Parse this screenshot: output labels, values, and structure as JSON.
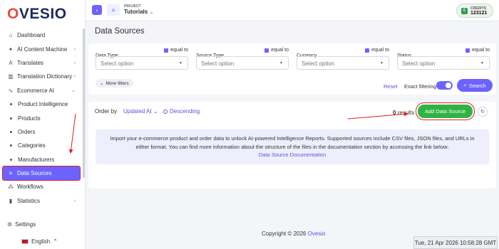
{
  "brand": {
    "logo_text": "OVESIO"
  },
  "sidebar": {
    "items": [
      {
        "label": "Dashboard",
        "icon": "home-icon"
      },
      {
        "label": "AI Content Machine",
        "icon": "sparkle-icon"
      },
      {
        "label": "Translates",
        "icon": "translate-icon"
      },
      {
        "label": "Translation Dictionary",
        "icon": "book-icon"
      },
      {
        "label": "Ecommerce AI",
        "icon": "ecommerce-icon"
      },
      {
        "label": "Product Intelligence"
      },
      {
        "label": "Products"
      },
      {
        "label": "Orders"
      },
      {
        "label": "Categories"
      },
      {
        "label": "Manufacturers"
      },
      {
        "label": "Data Sources",
        "icon": "database-icon"
      },
      {
        "label": "Workflows",
        "icon": "workflow-icon"
      },
      {
        "label": "Statistics",
        "icon": "statistics-icon"
      }
    ],
    "settings_label": "Settings",
    "language": "English"
  },
  "topbar": {
    "project_label": "PROJECT",
    "project_name": "Tutorials",
    "credits_label": "CREDITS",
    "credits_value": "123121"
  },
  "page": {
    "title": "Data Sources",
    "filters": [
      {
        "label": "Data Type",
        "match": "equal to",
        "placeholder": "Select option"
      },
      {
        "label": "Source Type",
        "match": "equal to",
        "placeholder": "Select option"
      },
      {
        "label": "Currency",
        "match": "equal to",
        "placeholder": "Select option"
      },
      {
        "label": "Status",
        "match": "equal to",
        "placeholder": "Select option"
      }
    ],
    "more_filters": "More filters",
    "reset": "Reset",
    "exact_filtering": "Exact filtering",
    "exact_filtering_on": true,
    "search": "Search",
    "order_by_label": "Order by",
    "order_by_value": "Updated At",
    "order_direction": "Descending",
    "results_count": "0",
    "results_label": "results",
    "add_button": "Add Data Source",
    "info_text": "Import your e-commerce product and order data to unlock AI-powered Intelligence Reports. Supported sources include CSV files, JSON files, and URLs in either format. You can find more information about the structure of the files in the documentation section by accessing the link below:",
    "info_link": "Data Source Documentation"
  },
  "footer": {
    "copyright": "Copyright © 2026",
    "brand": "Ovesio"
  },
  "clock": "Tue, 21 Apr 2026 10:58:28 GMT",
  "colors": {
    "accent": "#6c63ff",
    "success": "#2fb344",
    "highlight": "#e31b23"
  }
}
